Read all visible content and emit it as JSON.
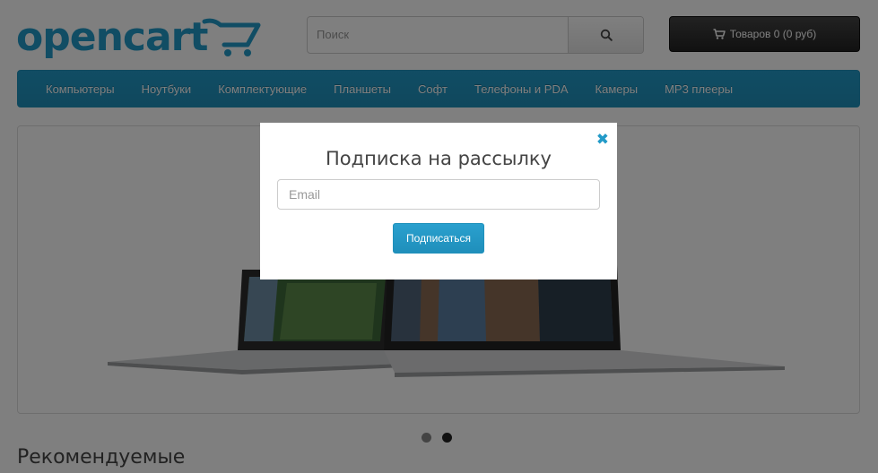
{
  "header": {
    "logo_text": "opencart",
    "search_placeholder": "Поиск",
    "cart_label": "Товаров 0 (0 руб)"
  },
  "menu": {
    "items": [
      {
        "label": "Компьютеры"
      },
      {
        "label": "Ноутбуки"
      },
      {
        "label": "Комплектующие"
      },
      {
        "label": "Планшеты"
      },
      {
        "label": "Софт"
      },
      {
        "label": "Телефоны и PDA"
      },
      {
        "label": "Камеры"
      },
      {
        "label": "MP3 плееры"
      }
    ]
  },
  "slideshow": {
    "slide_count": 2,
    "active_slide": 2
  },
  "featured": {
    "title": "Рекомендуемые"
  },
  "modal": {
    "title": "Подписка на рассылку",
    "email_placeholder": "Email",
    "submit_label": "Подписаться",
    "close_glyph": "✖"
  },
  "colors": {
    "brand": "#229ac8",
    "cart_button": "#333333",
    "overlay": "rgba(0,0,0,0.5)"
  }
}
